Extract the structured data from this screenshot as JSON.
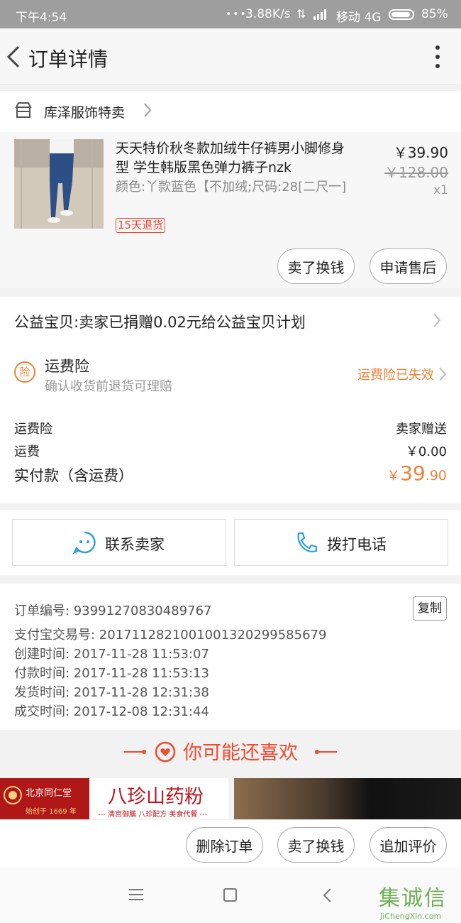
{
  "status_bar": {
    "time": "下午4:54",
    "speed": "3.88K/s",
    "carrier": "移动 4G",
    "battery": "85%"
  },
  "nav": {
    "title": "订单详情"
  },
  "shop": {
    "name": "库泽服饰特卖"
  },
  "product": {
    "title": "天天特价秋冬款加绒牛仔裤男小脚修身型 学生韩版黑色弹力裤子nzk",
    "spec": "颜色:丫款蓝色【不加绒;尺码:28[二尺一]",
    "return_badge": "15天退货",
    "price": "￥39.90",
    "original_price": "￥128.00",
    "quantity": "x1",
    "buttons": [
      "卖了换钱",
      "申请售后"
    ]
  },
  "charity": {
    "text": "公益宝贝:卖家已捐赠0.02元给公益宝贝计划"
  },
  "insurance": {
    "icon_text": "险",
    "title": "运费险",
    "subtitle": "确认收货前退货可理赔",
    "status": "运费险已失效"
  },
  "fees": {
    "rows": [
      {
        "label": "运费险",
        "value": "卖家赠送"
      },
      {
        "label": "运费",
        "value": "￥0.00"
      }
    ],
    "total_label": "实付款（含运费）",
    "total_currency": "￥",
    "total_int": "39",
    "total_dec": ".90"
  },
  "contact": {
    "contact_seller": "联系卖家",
    "call_phone": "拨打电话"
  },
  "order_info": {
    "order_no": "订单编号: 93991270830489767",
    "copy": "复制",
    "alipay_no": "支付宝交易号: 2017112821001001320299585679",
    "created": "创建时间: 2017-11-28 11:53:07",
    "paid": "付款时间: 2017-11-28 11:53:13",
    "shipped": "发货时间: 2017-11-28 12:31:38",
    "completed": "成交时间: 2017-12-08 12:31:44"
  },
  "recommend": {
    "title": "你可能还喜欢"
  },
  "ad": {
    "brand": "北京同仁堂",
    "since": "始创于 1669 年",
    "product": "八珍山药粉",
    "tagline": "--- 清宫御膳 八珍配方 美食代餐 ---"
  },
  "bottom_actions": [
    "删除订单",
    "卖了换钱",
    "追加评价"
  ],
  "watermark": {
    "mark": "集诚信",
    "url": "JiChengXin.com"
  },
  "colors": {
    "accent": "#f27f33",
    "recommend": "#f04a2f",
    "badge": "#e43"
  }
}
